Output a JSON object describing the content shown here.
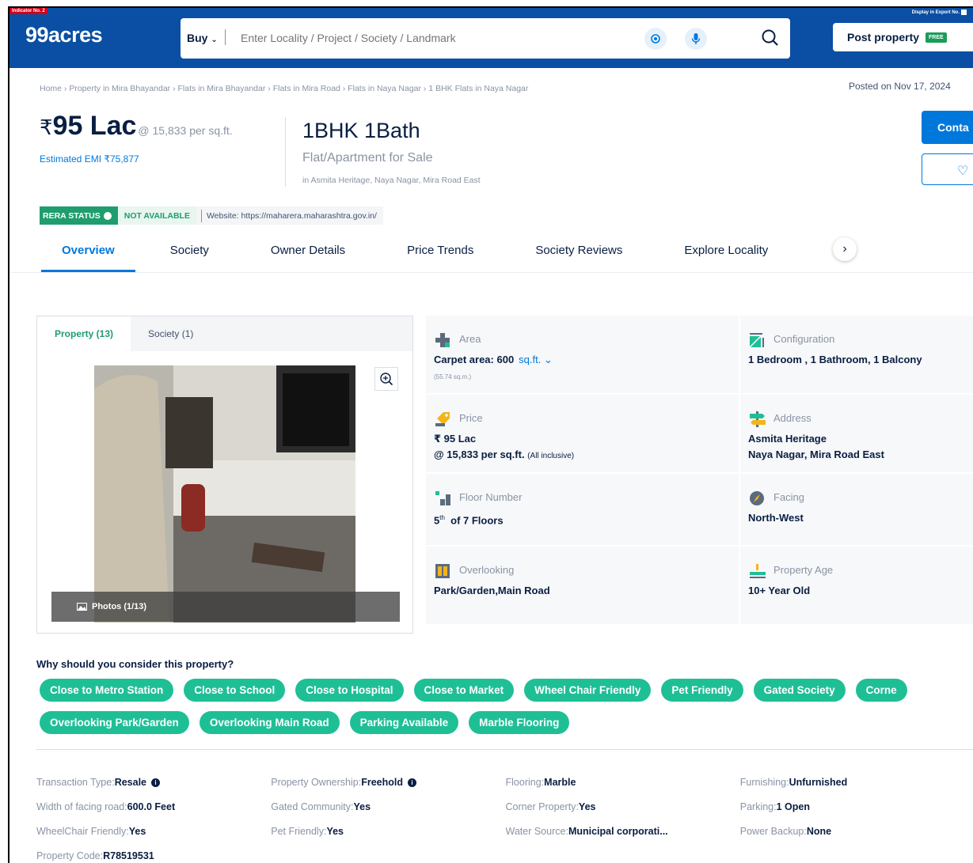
{
  "header": {
    "indicator_tag": "Indicator No. 2",
    "display_tag": "Display in Export No.",
    "logo": "99acres",
    "buy_label": "Buy",
    "search_placeholder": "Enter Locality / Project / Society / Landmark",
    "post_property_label": "Post property",
    "free_badge": "FREE"
  },
  "breadcrumb": "Home › Property in Mira Bhayandar › Flats in Mira Bhayandar › Flats in Mira Road › Flats in Naya Nagar › 1 BHK Flats in Naya Nagar",
  "posted_on": "Posted on Nov 17, 2024",
  "listing": {
    "currency": "₹",
    "price": "95 Lac",
    "per_sqft": "@ 15,833 per sq.ft.",
    "emi": "Estimated EMI ₹75,877",
    "config_title": "1BHK 1Bath",
    "type": "Flat/Apartment for Sale",
    "location": "in Asmita Heritage, Naya Nagar, Mira Road East",
    "contact_label": "Conta",
    "favourite_icon": "heart-icon"
  },
  "rera": {
    "label": "RERA STATUS",
    "status": "NOT AVAILABLE",
    "website": "Website: https://maharera.maharashtra.gov.in/"
  },
  "tabs": [
    "Overview",
    "Society",
    "Owner Details",
    "Price Trends",
    "Society Reviews",
    "Explore Locality"
  ],
  "gallery": {
    "tabs": [
      "Property (13)",
      "Society (1)"
    ],
    "photos_label": "Photos (1/13)"
  },
  "details": {
    "area": {
      "label": "Area",
      "value": "Carpet area: 600",
      "unit": "sq.ft.",
      "sub": "(55.74 sq.m.)"
    },
    "configuration": {
      "label": "Configuration",
      "value": "1 Bedroom , 1 Bathroom, 1 Balcony"
    },
    "price": {
      "label": "Price",
      "value": "₹ 95 Lac",
      "value2": "@ 15,833 per sq.ft.",
      "note": "(All inclusive)"
    },
    "address": {
      "label": "Address",
      "line1": "Asmita Heritage",
      "line2": "Naya Nagar, Mira Road East"
    },
    "floor": {
      "label": "Floor Number",
      "floor_num": "5",
      "floor_sup": "th",
      "floor_rest": "of 7 Floors"
    },
    "facing": {
      "label": "Facing",
      "value": "North-West"
    },
    "overlooking": {
      "label": "Overlooking",
      "value": "Park/Garden,Main Road"
    },
    "age": {
      "label": "Property Age",
      "value": "10+ Year Old"
    }
  },
  "why_title": "Why should you consider this property?",
  "reasons_row1": [
    "Close to Metro Station",
    "Close to School",
    "Close to Hospital",
    "Close to Market",
    "Wheel Chair Friendly",
    "Pet Friendly",
    "Gated Society",
    "Corne"
  ],
  "reasons_row2": [
    "Overlooking Park/Garden",
    "Overlooking Main Road",
    "Parking Available",
    "Marble Flooring"
  ],
  "props": [
    [
      {
        "k": "Transaction Type",
        "v": "Resale",
        "info": true
      },
      {
        "k": "Property Ownership",
        "v": "Freehold",
        "info": true
      },
      {
        "k": "Flooring",
        "v": "Marble"
      },
      {
        "k": "Furnishing",
        "v": "Unfurnished"
      }
    ],
    [
      {
        "k": "Width of facing road",
        "v": "600.0 Feet"
      },
      {
        "k": "Gated Community",
        "v": "Yes"
      },
      {
        "k": "Corner Property",
        "v": "Yes"
      },
      {
        "k": "Parking",
        "v": "1 Open"
      }
    ],
    [
      {
        "k": "WheelChair Friendly",
        "v": "Yes"
      },
      {
        "k": "Pet Friendly",
        "v": "Yes"
      },
      {
        "k": "Water Source",
        "v": "Municipal corporati..."
      },
      {
        "k": "Power Backup",
        "v": "None"
      }
    ],
    [
      {
        "k": "Property Code",
        "v": "R78519531"
      }
    ]
  ],
  "colors": {
    "brand": "#0A4FA3",
    "accent": "#0078DB",
    "chip": "#1fbf96",
    "rera": "#1f9d6e"
  }
}
